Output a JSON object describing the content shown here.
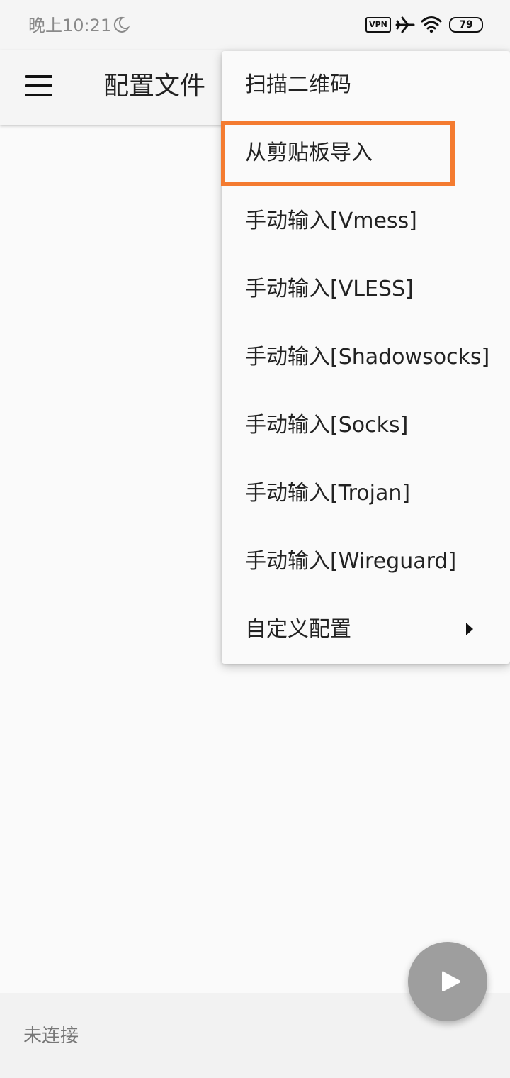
{
  "status_bar": {
    "time": "晚上10:21",
    "moon_icon": "moon-icon",
    "vpn_label": "VPN",
    "airplane_icon": "airplane-icon",
    "wifi_icon": "wifi-icon",
    "battery_level": "79"
  },
  "app_bar": {
    "menu_icon": "hamburger-menu-icon",
    "title": "配置文件"
  },
  "popup_menu": {
    "items": [
      {
        "label": "扫描二维码"
      },
      {
        "label": "从剪贴板导入",
        "highlighted": true
      },
      {
        "label": "手动输入[Vmess]"
      },
      {
        "label": "手动输入[VLESS]"
      },
      {
        "label": "手动输入[Shadowsocks]"
      },
      {
        "label": "手动输入[Socks]"
      },
      {
        "label": "手动输入[Trojan]"
      },
      {
        "label": "手动输入[Wireguard]"
      },
      {
        "label": "自定义配置",
        "has_submenu": true
      }
    ]
  },
  "bottom_bar": {
    "status": "未连接"
  },
  "fab": {
    "icon": "play-icon"
  },
  "colors": {
    "highlight": "#f47b30",
    "fab": "#9e9e9e",
    "background": "#fafafa"
  }
}
